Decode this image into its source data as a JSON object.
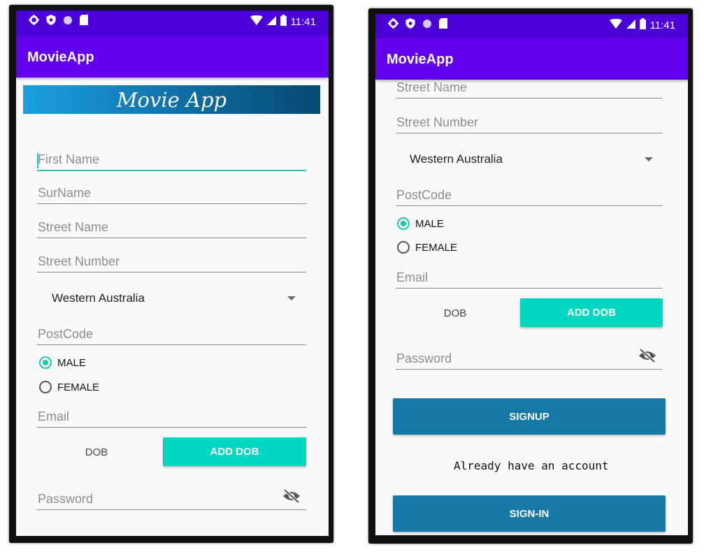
{
  "status_bar": {
    "time": "11:41"
  },
  "app_title": "MovieApp",
  "banner_text": "Movie App",
  "form": {
    "first_name_placeholder": "First Name",
    "surname_placeholder": "SurName",
    "street_name_placeholder": "Street Name",
    "street_number_placeholder": "Street Number",
    "state_selected": "Western Australia",
    "postcode_placeholder": "PostCode",
    "gender_options": [
      "MALE",
      "FEMALE"
    ],
    "gender_selected": "MALE",
    "email_placeholder": "Email",
    "dob_label": "DOB",
    "add_dob_label": "ADD DOB",
    "password_placeholder": "Password"
  },
  "actions": {
    "signup_label": "SIGNUP",
    "already_account_text": "Already have an account",
    "signin_label": "SIGN-IN"
  },
  "colors": {
    "status_bar": "#4b00d6",
    "app_bar": "#6200ee",
    "accent": "#00d7c3",
    "primary_button": "#1779a8"
  },
  "icons": [
    "gear-icon",
    "shield-icon",
    "circle-icon",
    "sim-card-icon",
    "wifi-icon",
    "signal-icon",
    "battery-icon",
    "eye-off-icon",
    "dropdown-arrow-icon"
  ]
}
